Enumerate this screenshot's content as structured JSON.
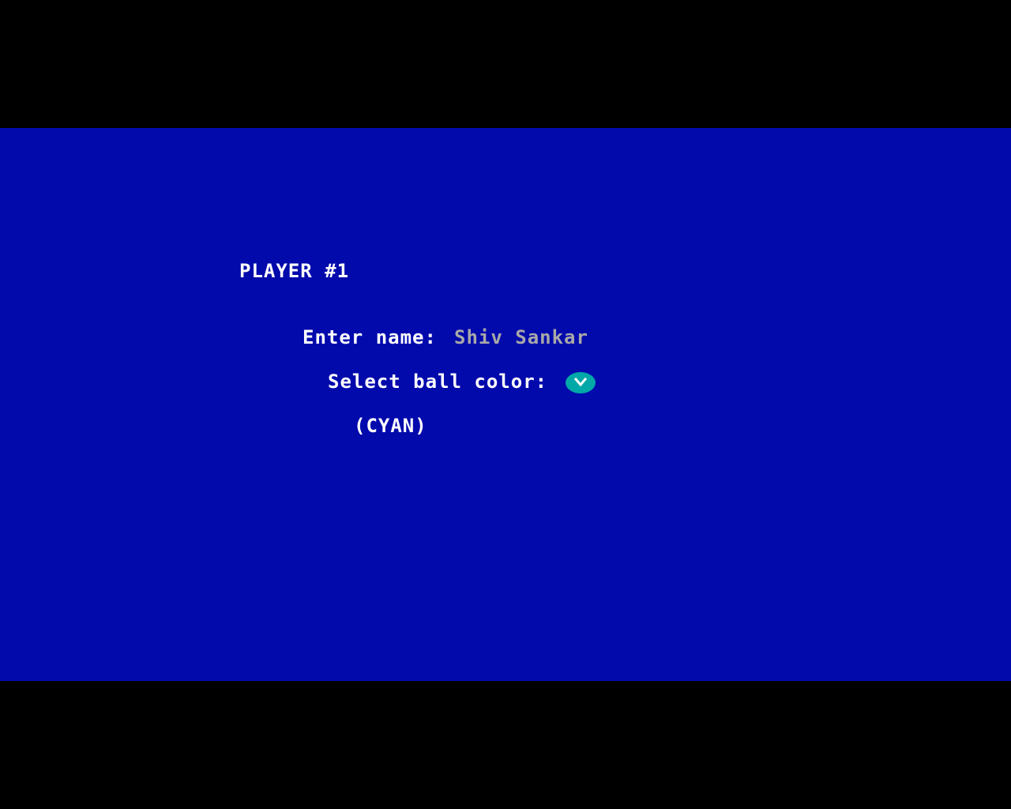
{
  "colors": {
    "background": "#000000",
    "playfield": "#020aac",
    "text": "#ffffff",
    "input_text": "#a8a8a8",
    "ball_color": "#00a8a8"
  },
  "player": {
    "title": "PLAYER #1",
    "name_label": "Enter name:",
    "name_value": "Shiv Sankar",
    "color_label": "Select ball color:",
    "ball_icon": "chevron-down-icon",
    "color_name": "(CYAN)"
  }
}
